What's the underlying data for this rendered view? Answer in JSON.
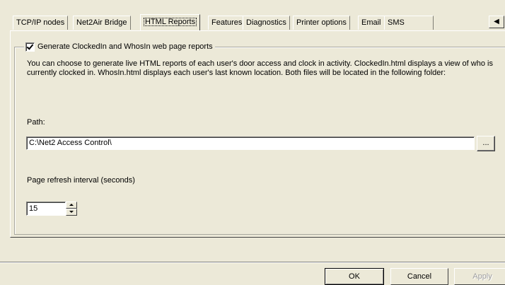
{
  "tabs": [
    {
      "label": "TCP/IP nodes",
      "active": false
    },
    {
      "label": "Net2Air Bridge",
      "active": false
    },
    {
      "label": "HTML Reports",
      "active": true
    },
    {
      "label": "Features",
      "active": false
    },
    {
      "label": "Diagnostics",
      "active": false
    },
    {
      "label": "Printer options",
      "active": false
    },
    {
      "label": "Email",
      "active": false
    },
    {
      "label": "SMS",
      "active": false
    }
  ],
  "tab_scroll_glyph": "◀",
  "group": {
    "checkbox_label": "Generate ClockedIn and WhosIn web page reports",
    "checked": true,
    "description": "You can choose to generate live HTML reports of each user's door access and clock in activity. ClockedIn.html displays a view of who is currently clocked in. WhosIn.html displays each user's last known location. Both files will be located in the following folder:",
    "path_label": "Path:",
    "path_value": "C:\\Net2 Access Control\\",
    "browse_label": "...",
    "refresh_label": "Page refresh interval (seconds)",
    "refresh_value": "15"
  },
  "footer": {
    "ok_label": "OK",
    "cancel_label": "Cancel",
    "apply_label": "Apply"
  }
}
